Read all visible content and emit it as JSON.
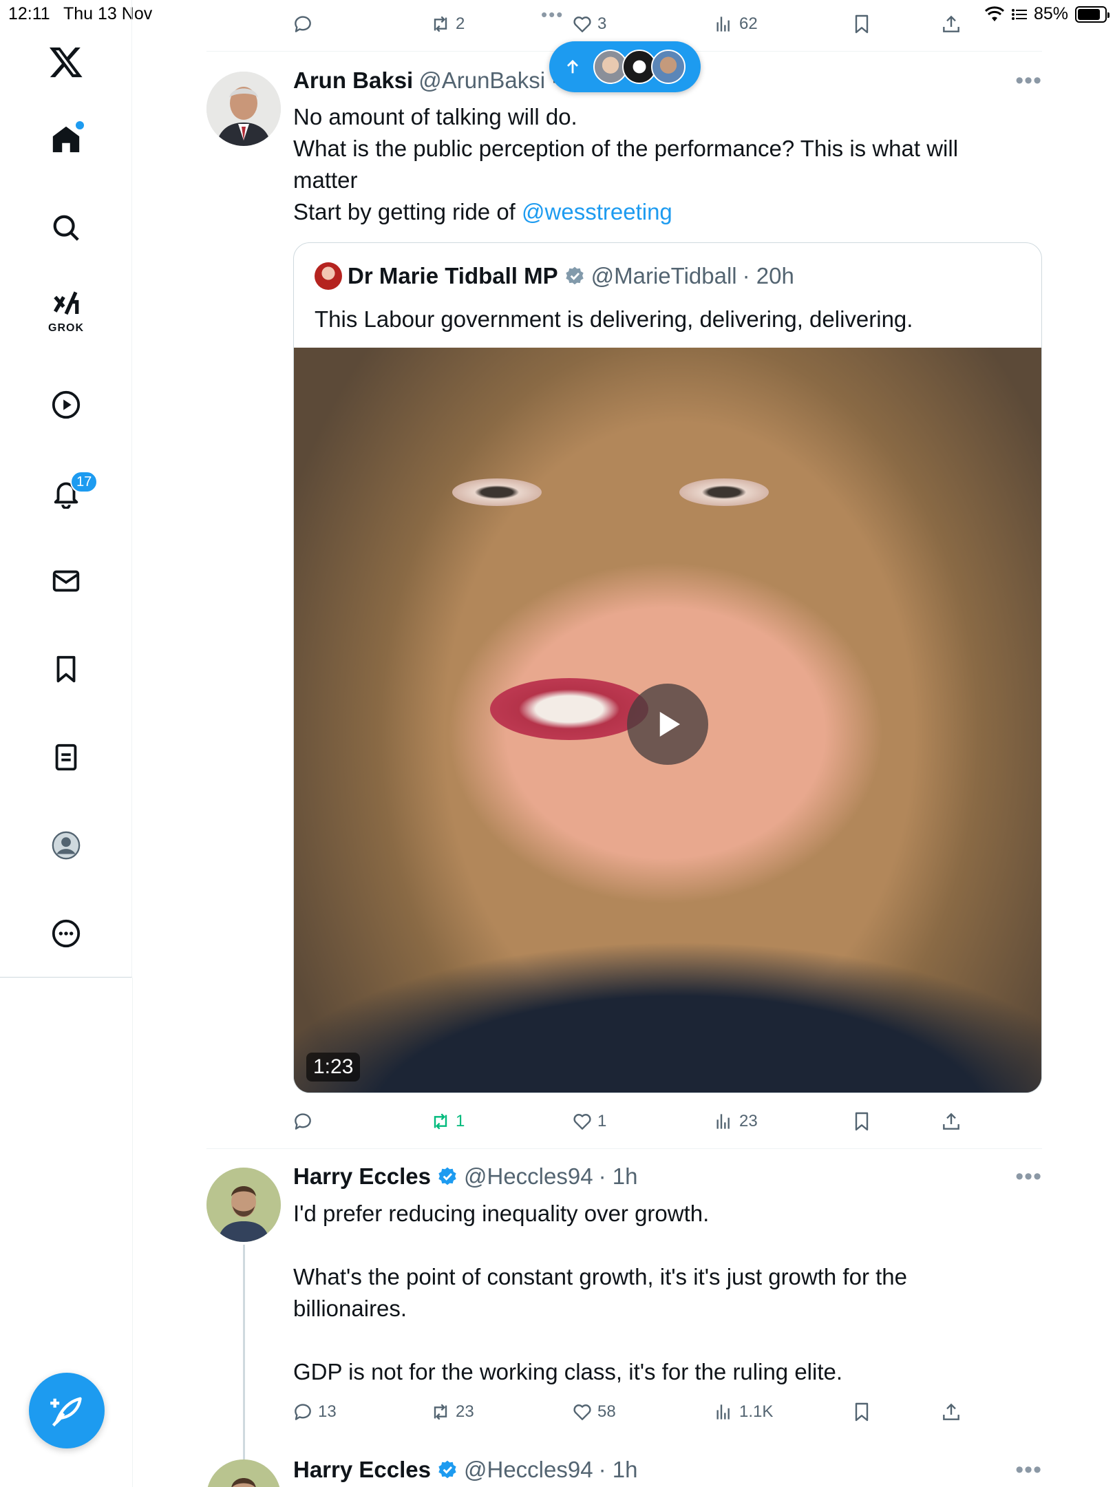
{
  "status_bar": {
    "time": "12:11",
    "date": "Thu 13 Nov",
    "battery": "85%",
    "battery_level": 0.85
  },
  "sidebar": {
    "items": [
      {
        "name": "home",
        "icon": "home-icon"
      },
      {
        "name": "explore",
        "icon": "search-icon"
      },
      {
        "name": "grok",
        "icon": "grok-icon",
        "label": "GROK"
      },
      {
        "name": "video",
        "icon": "play-icon"
      },
      {
        "name": "notifications",
        "icon": "bell-icon",
        "badge": "17"
      },
      {
        "name": "messages",
        "icon": "mail-icon"
      },
      {
        "name": "bookmarks",
        "icon": "bookmark-icon"
      },
      {
        "name": "lists",
        "icon": "list-icon"
      },
      {
        "name": "profile",
        "icon": "profile-icon"
      },
      {
        "name": "more",
        "icon": "more-circle-icon"
      }
    ]
  },
  "top_actions": {
    "reposts": "2",
    "likes": "3",
    "views": "62"
  },
  "new_posts_pill": {
    "icon": "arrow-up-icon"
  },
  "tweets": [
    {
      "name": "Arun Baksi",
      "handle": "@ArunBaksi",
      "separator": "·",
      "lines": [
        "No amount of talking will do.",
        "What is the public perception of the performance? This is what will",
        "matter"
      ],
      "last_line_prefix": "Start by getting ride of ",
      "mention": "@wesstreeting",
      "quote": {
        "name": "Dr Marie Tidball MP",
        "handle": "@MarieTidball",
        "time": "· 20h",
        "text": "This Labour government is delivering, delivering, delivering.",
        "video_duration": "1:23"
      },
      "actions": {
        "replies": "",
        "reposts": "1",
        "likes": "1",
        "views": "23"
      }
    },
    {
      "name": "Harry Eccles",
      "handle": "@Heccles94",
      "time": "· 1h",
      "paragraphs": [
        "I'd prefer reducing inequality over growth.",
        "",
        "What's the point of constant growth, it's it's just growth for the",
        "billionaires.",
        "",
        "GDP is not for the working class, it's for the ruling elite."
      ],
      "actions": {
        "replies": "13",
        "reposts": "23",
        "likes": "58",
        "views": "1.1K"
      }
    },
    {
      "name": "Harry Eccles",
      "handle": "@Heccles94",
      "time": "· 1h"
    }
  ],
  "colors": {
    "accent": "#1d9bf0",
    "repost_active": "#00ba7c",
    "muted": "#536471"
  }
}
